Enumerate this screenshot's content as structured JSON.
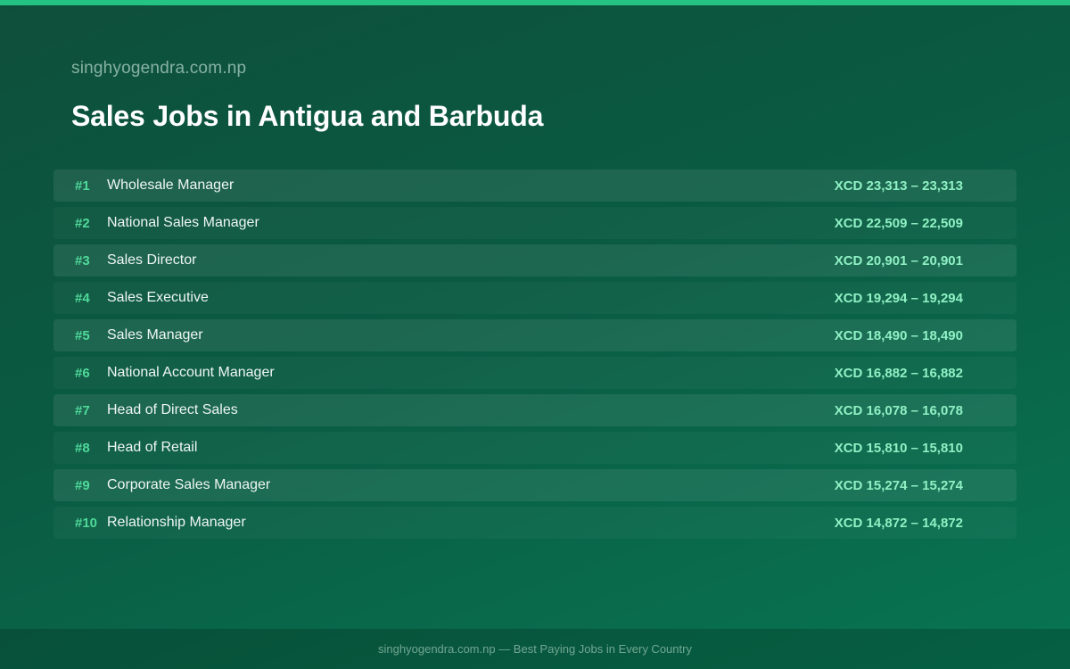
{
  "header": {
    "site_name": "singhyogendra.com.np",
    "title": "Sales Jobs in Antigua and Barbuda"
  },
  "jobs": [
    {
      "rank": "#1",
      "title": "Wholesale Manager",
      "salary": "XCD 23,313 – 23,313"
    },
    {
      "rank": "#2",
      "title": "National Sales Manager",
      "salary": "XCD 22,509 – 22,509"
    },
    {
      "rank": "#3",
      "title": "Sales Director",
      "salary": "XCD 20,901 – 20,901"
    },
    {
      "rank": "#4",
      "title": "Sales Executive",
      "salary": "XCD 19,294 – 19,294"
    },
    {
      "rank": "#5",
      "title": "Sales Manager",
      "salary": "XCD 18,490 – 18,490"
    },
    {
      "rank": "#6",
      "title": "National Account Manager",
      "salary": "XCD 16,882 – 16,882"
    },
    {
      "rank": "#7",
      "title": "Head of Direct Sales",
      "salary": "XCD 16,078 – 16,078"
    },
    {
      "rank": "#8",
      "title": "Head of Retail",
      "salary": "XCD 15,810 – 15,810"
    },
    {
      "rank": "#9",
      "title": "Corporate Sales Manager",
      "salary": "XCD 15,274 – 15,274"
    },
    {
      "rank": "#10",
      "title": "Relationship Manager",
      "salary": "XCD 14,872 – 14,872"
    }
  ],
  "footer": {
    "text": "singhyogendra.com.np — Best Paying Jobs in Every Country"
  },
  "colors": {
    "accent": "#25c383",
    "rank": "#4fd99a",
    "salary": "#8ff0c4",
    "background_start": "#0e4f3b",
    "background_end": "#087552"
  }
}
